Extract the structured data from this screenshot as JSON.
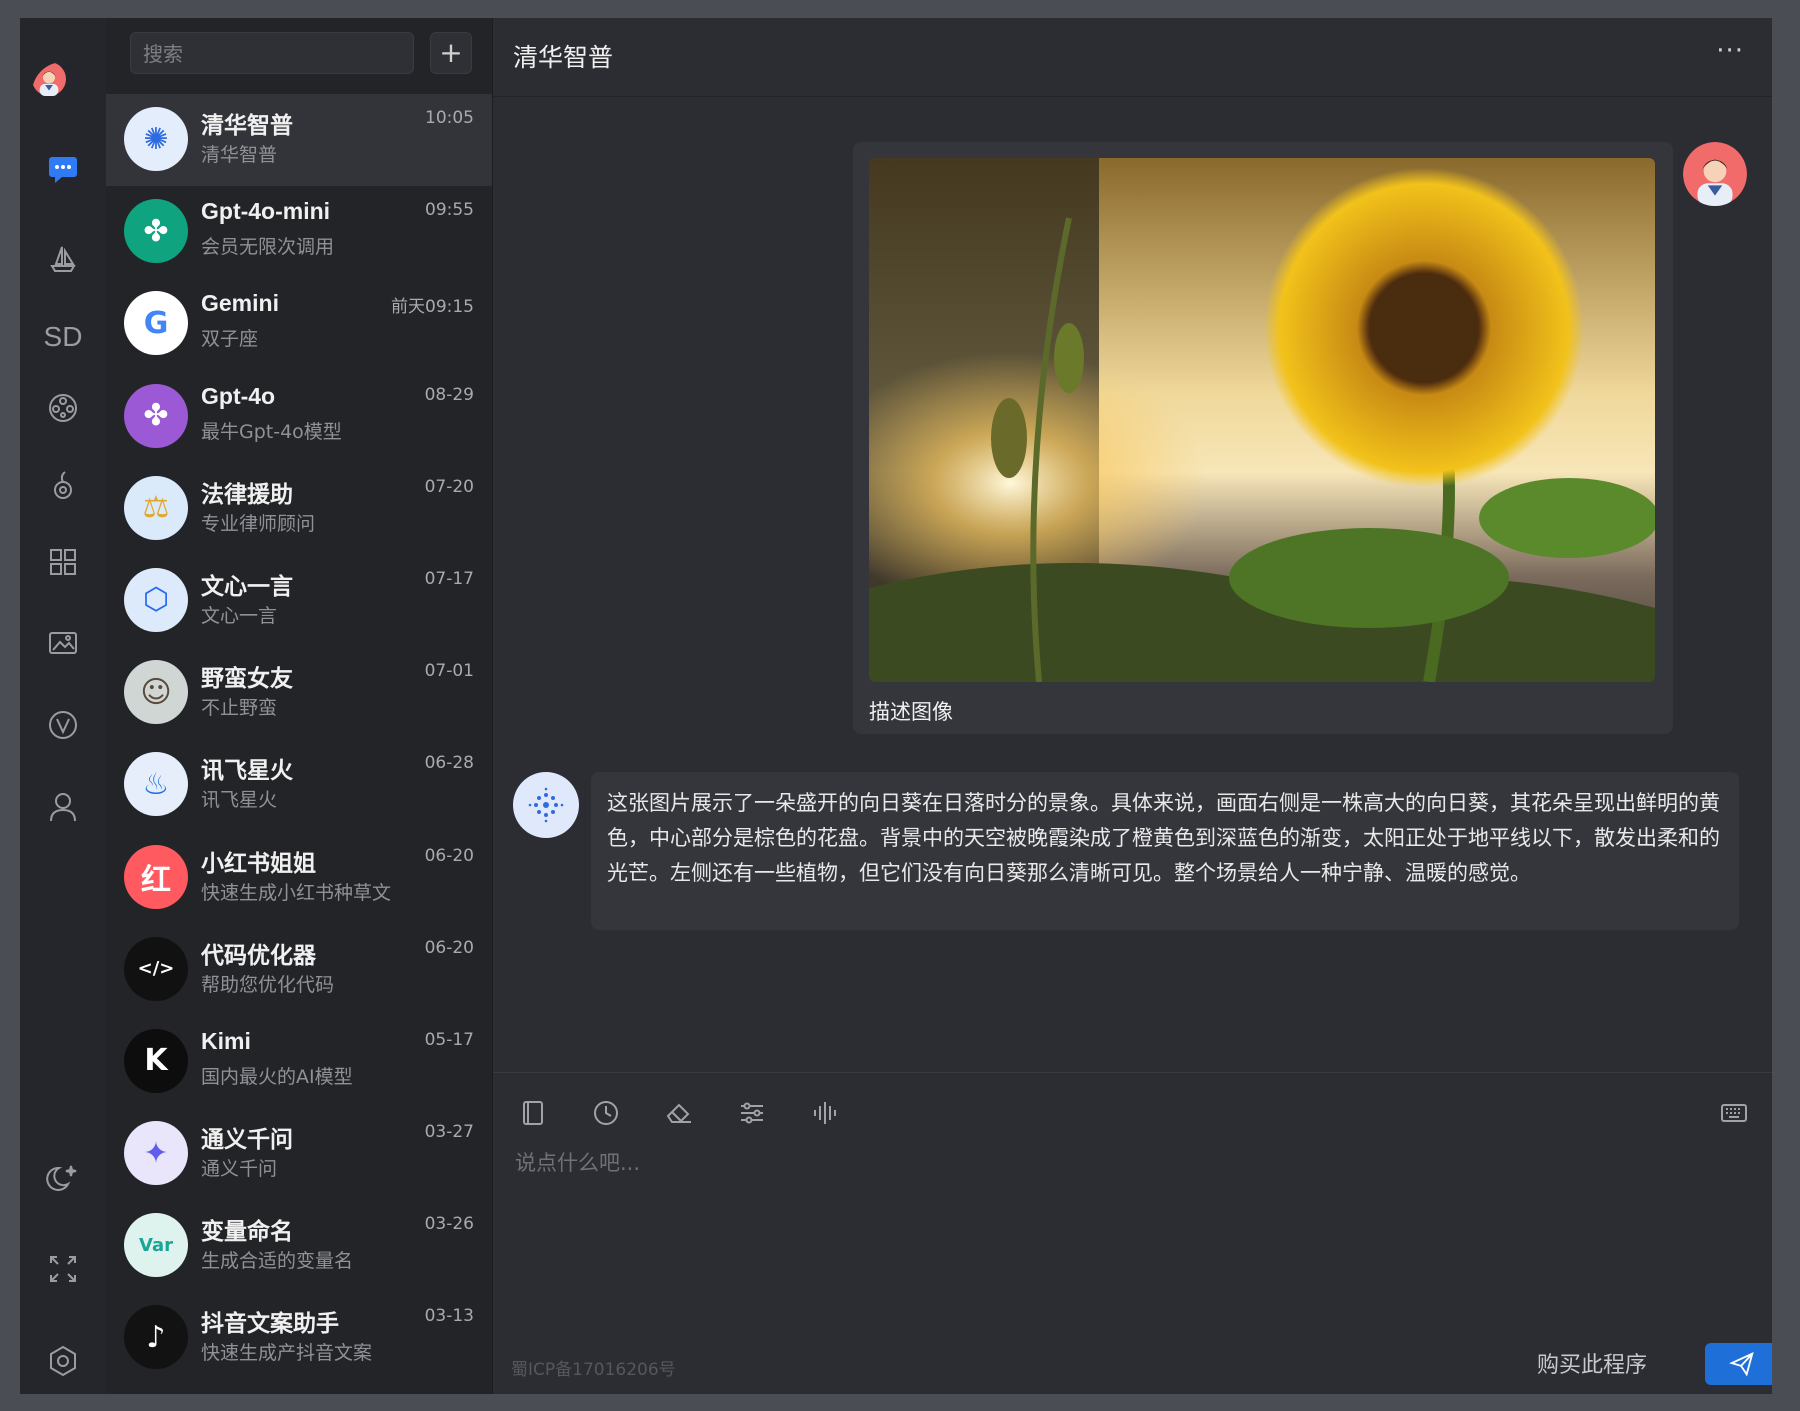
{
  "rail": {
    "items": [
      "chat-icon",
      "sailboat-icon",
      "sd-icon",
      "film-reel-icon",
      "music-note-icon",
      "apps-grid-icon",
      "image-gallery-icon",
      "v-badge-icon",
      "user-icon"
    ],
    "bottom": [
      "moon-icon",
      "fullscreen-icon",
      "settings-hex-icon"
    ],
    "sd_label": "SD"
  },
  "list": {
    "search_placeholder": "搜索",
    "add_label": "+",
    "conversations": [
      {
        "name": "清华智普",
        "sub": "清华智普",
        "time": "10:05",
        "color": "#e4edfb",
        "glyph": "✺",
        "glyphColor": "#2f6be0"
      },
      {
        "name": "Gpt-4o-mini",
        "sub": "会员无限次调用",
        "time": "09:55",
        "color": "#10a37f",
        "glyph": "✤",
        "glyphColor": "#ffffff"
      },
      {
        "name": "Gemini",
        "sub": "双子座",
        "time": "前天09:15",
        "color": "#ffffff",
        "glyph": "G",
        "glyphColor": "#4285f4"
      },
      {
        "name": "Gpt-4o",
        "sub": "最牛Gpt-4o模型",
        "time": "08-29",
        "color": "#9b59d6",
        "glyph": "✤",
        "glyphColor": "#ffffff"
      },
      {
        "name": "法律援助",
        "sub": "专业律师顾问",
        "time": "07-20",
        "color": "#dbeafb",
        "glyph": "⚖",
        "glyphColor": "#e0a82e"
      },
      {
        "name": "文心一言",
        "sub": "文心一言",
        "time": "07-17",
        "color": "#ddeafb",
        "glyph": "⬡",
        "glyphColor": "#2468f2"
      },
      {
        "name": "野蛮女友",
        "sub": "不止野蛮",
        "time": "07-01",
        "color": "#cfd6d4",
        "glyph": "☺",
        "glyphColor": "#5a4a3c"
      },
      {
        "name": "讯飞星火",
        "sub": "讯飞星火",
        "time": "06-28",
        "color": "#e6eefb",
        "glyph": "♨",
        "glyphColor": "#1d6fe0"
      },
      {
        "name": "小红书姐姐",
        "sub": "快速生成小红书种草文",
        "time": "06-20",
        "color": "#fe5a5f",
        "glyph": "红",
        "glyphColor": "#ffffff"
      },
      {
        "name": "代码优化器",
        "sub": "帮助您优化代码",
        "time": "06-20",
        "color": "#111111",
        "glyph": "</>",
        "glyphColor": "#ffffff"
      },
      {
        "name": "Kimi",
        "sub": "国内最火的AI模型",
        "time": "05-17",
        "color": "#0d0d0d",
        "glyph": "K",
        "glyphColor": "#ffffff"
      },
      {
        "name": "通义千问",
        "sub": "通义千问",
        "time": "03-27",
        "color": "#e9e6fb",
        "glyph": "✦",
        "glyphColor": "#615ced"
      },
      {
        "name": "变量命名",
        "sub": "生成合适的变量名",
        "time": "03-26",
        "color": "#dff3ee",
        "glyph": "Var",
        "glyphColor": "#1aa596"
      },
      {
        "name": "抖音文案助手",
        "sub": "快速生成产抖音文案",
        "time": "03-13",
        "color": "#121212",
        "glyph": "♪",
        "glyphColor": "#ffffff"
      }
    ]
  },
  "header": {
    "title": "清华智普",
    "more": "···"
  },
  "chat": {
    "user_caption": "描述图像",
    "bot_reply": "这张图片展示了一朵盛开的向日葵在日落时分的景象。具体来说，画面右侧是一株高大的向日葵，其花朵呈现出鲜明的黄色，中心部分是棕色的花盘。背景中的天空被晚霞染成了橙黄色到深蓝色的渐变，太阳正处于地平线以下，散发出柔和的光芒。左侧还有一些植物，但它们没有向日葵那么清晰可见。整个场景给人一种宁静、温暖的感觉。"
  },
  "composer": {
    "tools": [
      "notebook-icon",
      "history-clock-icon",
      "eraser-icon",
      "sliders-icon",
      "voice-wave-icon"
    ],
    "placeholder": "说点什么吧...",
    "icp": "蜀ICP备17016206号",
    "buy_label": "购买此程序"
  },
  "colors": {
    "accent": "#1f6fd8",
    "active_chat_icon": "#2f7bf6"
  }
}
